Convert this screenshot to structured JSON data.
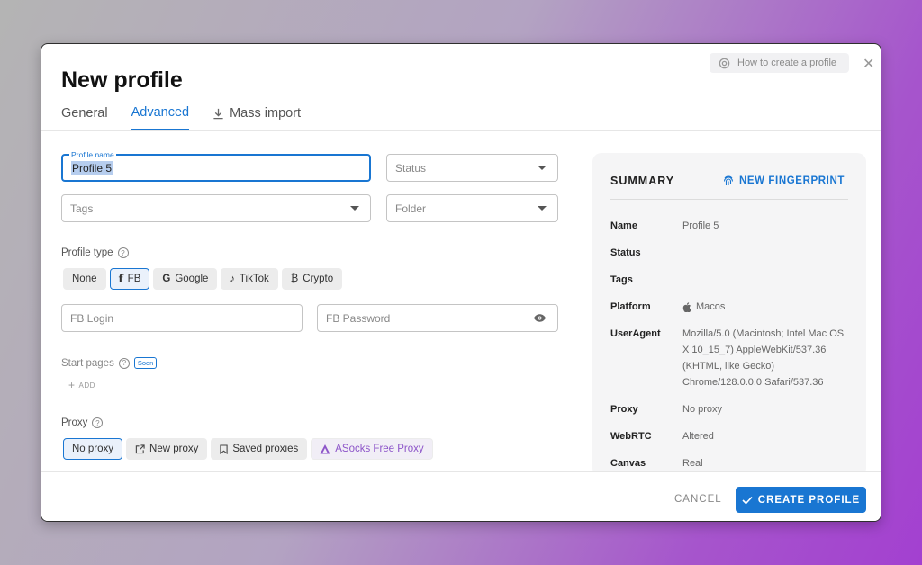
{
  "dialog": {
    "title": "New profile",
    "help_label": "How to create a profile"
  },
  "tabs": [
    {
      "label": "General"
    },
    {
      "label": "Advanced"
    },
    {
      "label": "Mass import"
    }
  ],
  "form": {
    "profile_name": {
      "label": "Profile name",
      "value": "Profile 5"
    },
    "status": {
      "placeholder": "Status"
    },
    "tags": {
      "placeholder": "Tags"
    },
    "folder": {
      "placeholder": "Folder"
    },
    "profile_type": {
      "label": "Profile type",
      "options": [
        "None",
        "FB",
        "Google",
        "TikTok",
        "Crypto"
      ],
      "selected": "FB"
    },
    "fb_login": {
      "placeholder": "FB Login"
    },
    "fb_password": {
      "placeholder": "FB Password"
    },
    "start_pages": {
      "label": "Start pages",
      "badge": "Soon",
      "add_label": "ADD"
    },
    "proxy": {
      "label": "Proxy",
      "options": [
        "No proxy",
        "New proxy",
        "Saved proxies",
        "ASocks Free Proxy"
      ],
      "selected": "No proxy"
    }
  },
  "summary": {
    "title": "SUMMARY",
    "fingerprint_button": "NEW FINGERPRINT",
    "rows": [
      {
        "key": "Name",
        "value": "Profile 5"
      },
      {
        "key": "Status",
        "value": ""
      },
      {
        "key": "Tags",
        "value": ""
      },
      {
        "key": "Platform",
        "value": "Macos"
      },
      {
        "key": "UserAgent",
        "value": "Mozilla/5.0 (Macintosh; Intel Mac OS X 10_15_7) AppleWebKit/537.36 (KHTML, like Gecko) Chrome/128.0.0.0 Safari/537.36"
      },
      {
        "key": "Proxy",
        "value": "No proxy"
      },
      {
        "key": "WebRTC",
        "value": "Altered"
      },
      {
        "key": "Canvas",
        "value": "Real"
      }
    ]
  },
  "footer": {
    "cancel_label": "CANCEL",
    "create_label": "CREATE PROFILE"
  },
  "colors": {
    "accent": "#1976d2",
    "asocks": "#8d55c9"
  }
}
